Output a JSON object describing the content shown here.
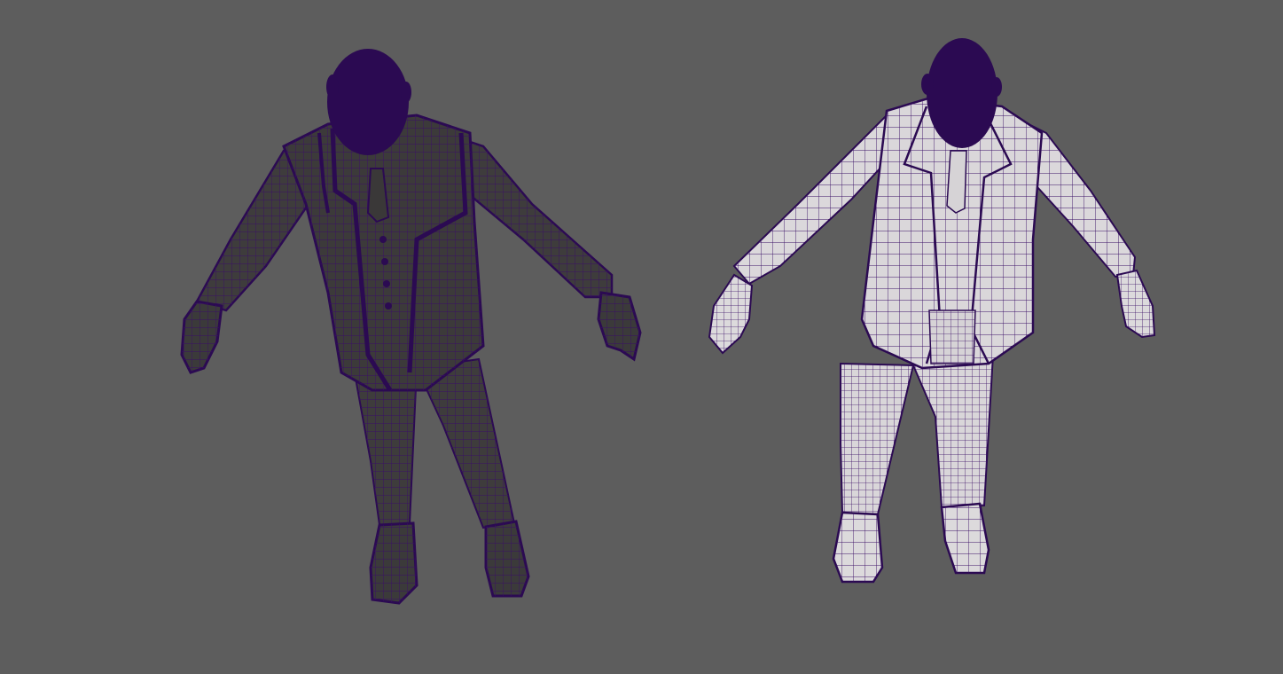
{
  "viewport": {
    "background_color": "#5d5d5d",
    "wireframe_color": "#3a0f66",
    "head_color": "#2b0a52"
  },
  "models": [
    {
      "id": "dense-mesh",
      "shading": "dark",
      "body_color": "#3d3b3b"
    },
    {
      "id": "low-mesh",
      "shading": "light",
      "body_color": "#d8d5d8"
    }
  ]
}
